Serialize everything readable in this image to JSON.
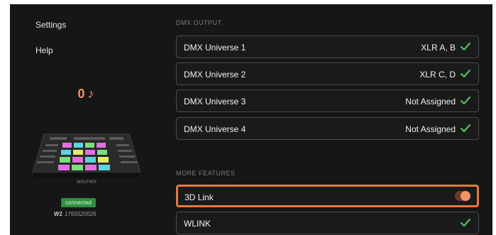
{
  "sidebar": {
    "items": [
      {
        "label": "Settings"
      },
      {
        "label": "Help"
      }
    ],
    "counter": {
      "value": "0",
      "icon": "music-note-icon",
      "glyph": "♪"
    },
    "device": {
      "brand": "WOLFMIX"
    },
    "status": {
      "badge": "connected",
      "device_id": "W1",
      "serial": "1765520026"
    }
  },
  "main": {
    "dmx_output": {
      "title": "DMX OUTPUT",
      "universes": [
        {
          "label": "DMX Universe 1",
          "value": "XLR A, B",
          "icon": "check-icon"
        },
        {
          "label": "DMX Universe 2",
          "value": "XLR C, D",
          "icon": "check-icon"
        },
        {
          "label": "DMX Universe 3",
          "value": "Not Assigned",
          "icon": "check-icon"
        },
        {
          "label": "DMX Universe 4",
          "value": "Not Assigned",
          "icon": "check-icon"
        }
      ]
    },
    "more_features": {
      "title": "MORE FEATURES",
      "items": [
        {
          "label": "3D Link",
          "control": "toggle",
          "on": true,
          "highlighted": true
        },
        {
          "label": "WLINK",
          "icon": "check-icon"
        }
      ]
    }
  },
  "colors": {
    "background": "#161616",
    "accent": "#f09562",
    "highlight_border": "#e7793f",
    "check": "#4cc45f",
    "badge": "#2f8f3e"
  }
}
